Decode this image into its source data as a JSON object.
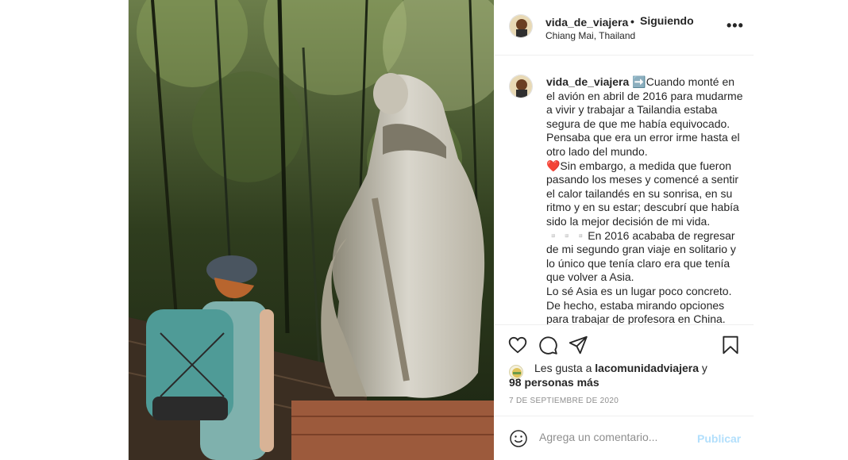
{
  "post": {
    "username": "vida_de_viajera",
    "follow_dot": "•",
    "follow_label": "Siguiendo",
    "location": "Chiang Mai, Thailand",
    "more_icon": "more-horizontal-icon",
    "more_glyph": "•••"
  },
  "caption": {
    "username": "vida_de_viajera",
    "paragraphs": [
      "➡️Cuando monté en el avión en abril de 2016 para mudarme a vivir y trabajar a Tailandia estaba segura de que me había equivocado. Pensaba que era un error irme hasta el otro lado del mundo.",
      "❤️Sin embargo, a medida que fueron pasando los meses y comencé a sentir el calor tailandés en su sonrisa, en su ritmo y en su estar; descubrí que había sido la mejor decisión de mi vida.",
      "▫️▫️▫️En 2016 acababa de regresar de mi segundo gran viaje en solitario y lo único que tenía claro era que tenía que volver a Asia.",
      "Lo sé Asia es un lugar poco concreto. De hecho, estaba mirando opciones para trabajar de profesora en China."
    ]
  },
  "actions": {
    "like_icon": "heart-icon",
    "comment_icon": "comment-icon",
    "share_icon": "share-icon",
    "save_icon": "bookmark-icon"
  },
  "likes": {
    "prefix": "Les gusta a ",
    "liker": "lacomunidadviajera",
    "connector": " y",
    "others": "98 personas más"
  },
  "date": "7 DE SEPTIEMBRE DE 2020",
  "comment": {
    "placeholder": "Agrega un comentario...",
    "publish_label": "Publicar",
    "emoji_icon": "smiley-icon"
  },
  "colors": {
    "text": "#262626",
    "muted": "#8e8e8e",
    "publish_disabled": "#b2dffc",
    "border": "#efefef"
  }
}
